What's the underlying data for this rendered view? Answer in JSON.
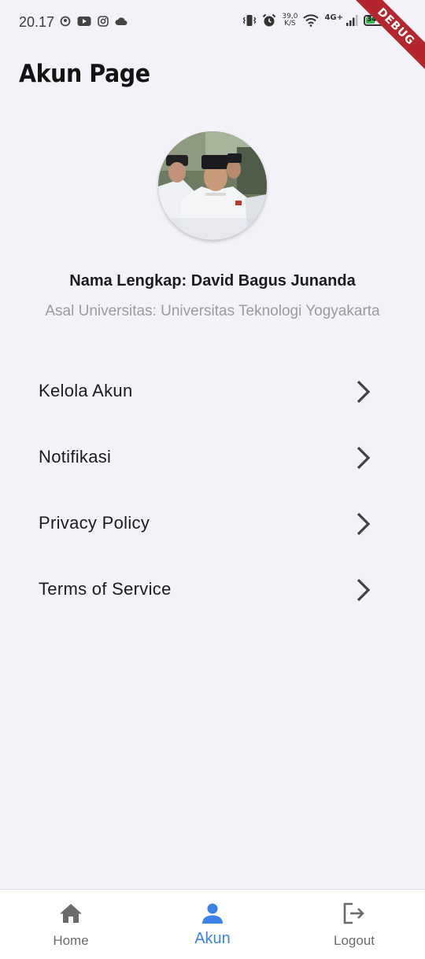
{
  "status_bar": {
    "time": "20.17",
    "net_speed_value": "39,0",
    "net_speed_unit": "K/S",
    "network_type": "4G+",
    "battery_level": "34"
  },
  "debug_banner": "DEBUG",
  "header": {
    "title": "Akun Page"
  },
  "profile": {
    "name": "Nama Lengkap: David Bagus Junanda",
    "university": "Asal Universitas: Universitas Teknologi Yogyakarta"
  },
  "menu": {
    "items": [
      {
        "label": "Kelola Akun"
      },
      {
        "label": "Notifikasi"
      },
      {
        "label": "Privacy Policy"
      },
      {
        "label": "Terms of Service"
      }
    ]
  },
  "bottom_nav": {
    "items": [
      {
        "label": "Home",
        "icon": "home-icon"
      },
      {
        "label": "Akun",
        "icon": "person-icon",
        "active": true
      },
      {
        "label": "Logout",
        "icon": "logout-icon"
      }
    ]
  },
  "colors": {
    "background": "#f3f2f8",
    "accent": "#3b82e8",
    "nav_inactive": "#6b6b6b",
    "debug_banner": "#b3262d"
  }
}
